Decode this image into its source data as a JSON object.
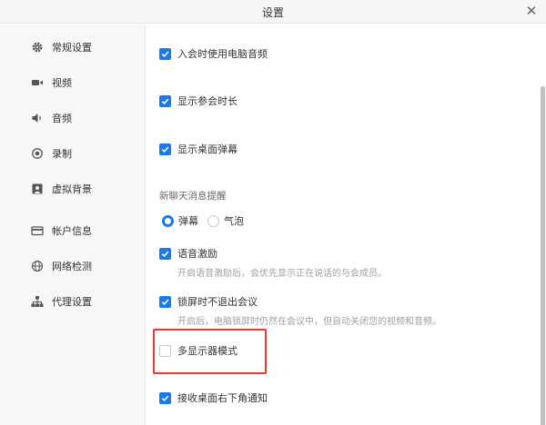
{
  "window": {
    "title": "设置"
  },
  "sidebar": {
    "items": [
      {
        "label": "常规设置",
        "icon": "gear-icon"
      },
      {
        "label": "视频",
        "icon": "video-camera-icon"
      },
      {
        "label": "音频",
        "icon": "speaker-icon"
      },
      {
        "label": "录制",
        "icon": "record-icon"
      },
      {
        "label": "虚拟背景",
        "icon": "virtual-background-icon"
      },
      {
        "label": "帐户信息",
        "icon": "id-card-icon"
      },
      {
        "label": "网络检测",
        "icon": "globe-icon"
      },
      {
        "label": "代理设置",
        "icon": "network-tree-icon"
      }
    ],
    "selected": "常规设置"
  },
  "settings": {
    "use_computer_audio": {
      "label": "入会时使用电脑音频",
      "checked": true
    },
    "show_meeting_duration": {
      "label": "显示参会时长",
      "checked": true
    },
    "show_desktop_barrage": {
      "label": "显示桌面弹幕",
      "checked": true
    },
    "new_chat_prompt": {
      "label": "新聊天消息提醒",
      "options": [
        "弹幕",
        "气泡"
      ],
      "selected": "弹幕"
    },
    "voice_motivation": {
      "label": "语音激励",
      "checked": true,
      "description": "开启语音激励后，会优先显示正在说话的与会成员。"
    },
    "lock_screen_stay": {
      "label": "锁屏时不退出会议",
      "checked": true,
      "description": "开启后，电脑锁屏时仍然在会议中，但自动关闭您的视频和音频。"
    },
    "multi_monitor_mode": {
      "label": "多显示器模式",
      "checked": false
    },
    "desktop_notifications": {
      "label": "接收桌面右下角通知",
      "checked": true
    }
  },
  "colors": {
    "accent": "#1a7ae6",
    "highlight": "#e8382f"
  }
}
